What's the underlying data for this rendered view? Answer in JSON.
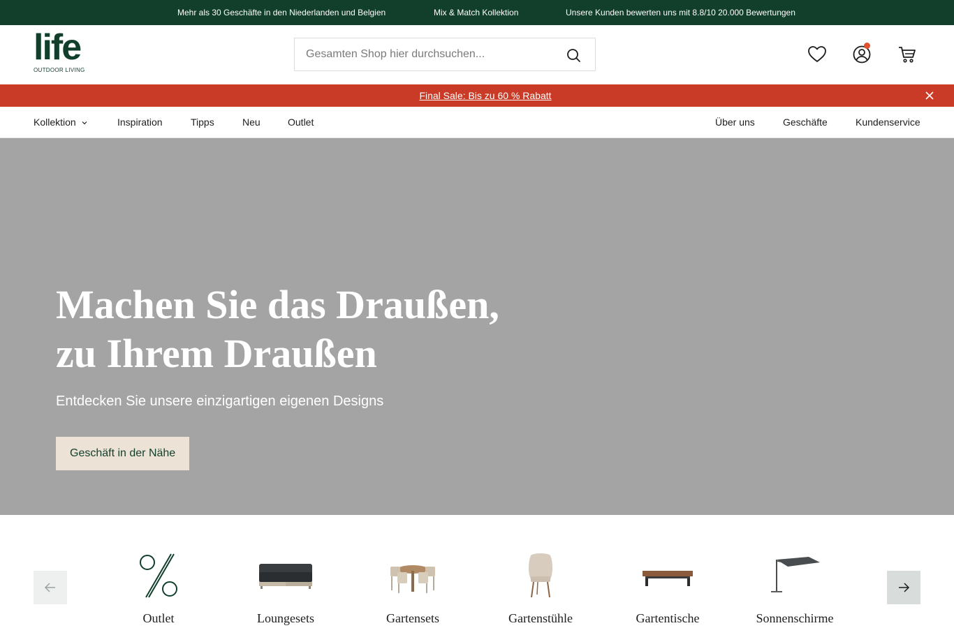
{
  "usp_bar": {
    "items": [
      "Mehr als 30 Geschäfte in den Niederlanden und Belgien",
      "Mix & Match Kollektion",
      "Unsere Kunden bewerten uns mit 8.8/10 20.000 Bewertungen"
    ]
  },
  "header": {
    "logo_word": "life",
    "logo_sub": "OUTDOOR LIVING",
    "search_placeholder": "Gesamten Shop hier durchsuchen...",
    "icons": [
      "heart-icon",
      "account-icon",
      "cart-icon"
    ]
  },
  "promo": {
    "text": "Final Sale: Bis zu 60 % Rabatt"
  },
  "nav": {
    "left": [
      "Kollektion",
      "Inspiration",
      "Tipps",
      "Neu",
      "Outlet"
    ],
    "right": [
      "Über uns",
      "Geschäfte",
      "Kundenservice"
    ]
  },
  "hero": {
    "title_line1": "Machen Sie das Draußen,",
    "title_line2": "zu Ihrem Draußen",
    "subtitle": "Entdecken Sie unsere einzigartigen eigenen Designs",
    "button": "Geschäft in der Nähe"
  },
  "categories": {
    "items": [
      "Outlet",
      "Loungesets",
      "Gartensets",
      "Gartenstühle",
      "Gartentische",
      "Sonnenschirme"
    ]
  },
  "colors": {
    "brand_green": "#123f2b",
    "promo_red": "#c93b26",
    "hero_grey": "#a4a4a4",
    "button_beige": "#ece2d6",
    "notification_dot": "#e0512d"
  }
}
